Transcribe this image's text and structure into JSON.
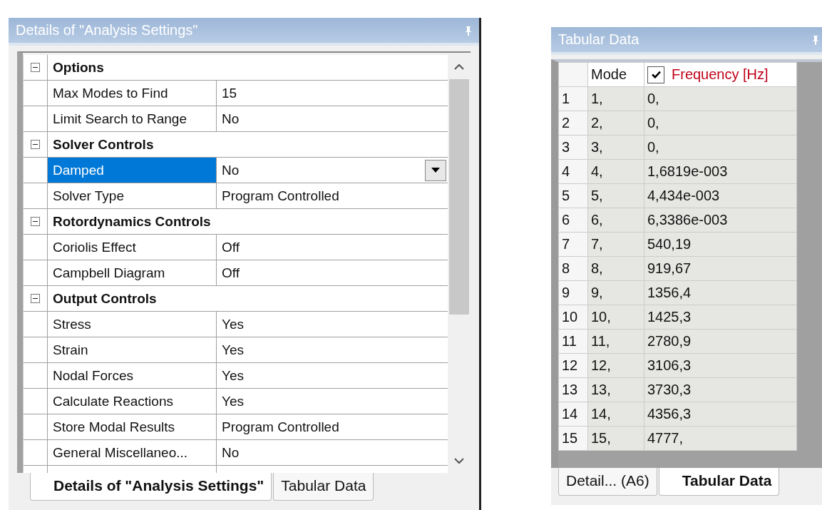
{
  "details_panel": {
    "title": "Details of \"Analysis Settings\"",
    "sections": [
      {
        "label": "Options",
        "expanded": true,
        "rows": [
          {
            "label": "Max Modes to Find",
            "value": "15",
            "selected": false
          },
          {
            "label": "Limit Search to Range",
            "value": "No",
            "selected": false
          }
        ]
      },
      {
        "label": "Solver Controls",
        "expanded": true,
        "rows": [
          {
            "label": "Damped",
            "value": "No",
            "selected": true
          },
          {
            "label": "Solver Type",
            "value": "Program Controlled",
            "selected": false
          }
        ]
      },
      {
        "label": "Rotordynamics Controls",
        "expanded": true,
        "rows": [
          {
            "label": "Coriolis Effect",
            "value": "Off",
            "selected": false
          },
          {
            "label": "Campbell Diagram",
            "value": "Off",
            "selected": false
          }
        ]
      },
      {
        "label": "Output Controls",
        "expanded": true,
        "rows": [
          {
            "label": "Stress",
            "value": "Yes",
            "selected": false
          },
          {
            "label": "Strain",
            "value": "Yes",
            "selected": false
          },
          {
            "label": "Nodal Forces",
            "value": "Yes",
            "selected": false
          },
          {
            "label": "Calculate Reactions",
            "value": "Yes",
            "selected": false
          },
          {
            "label": "Store Modal Results",
            "value": "Program Controlled",
            "selected": false
          },
          {
            "label": "General Miscellaneo...",
            "value": "No",
            "selected": false
          }
        ]
      }
    ],
    "tabs": [
      {
        "label": "Details of \"Analysis Settings\"",
        "selected": true
      },
      {
        "label": "Tabular Data",
        "selected": false
      }
    ]
  },
  "tabular_panel": {
    "title": "Tabular Data",
    "columns": [
      {
        "kind": "text",
        "label": "Mode"
      },
      {
        "kind": "checkbox",
        "label": "Frequency [Hz]",
        "checked": true
      }
    ],
    "rows": [
      {
        "index": "1",
        "mode": "1,",
        "frequency": "0,"
      },
      {
        "index": "2",
        "mode": "2,",
        "frequency": "0,"
      },
      {
        "index": "3",
        "mode": "3,",
        "frequency": "0,"
      },
      {
        "index": "4",
        "mode": "4,",
        "frequency": "1,6819e-003"
      },
      {
        "index": "5",
        "mode": "5,",
        "frequency": "4,434e-003"
      },
      {
        "index": "6",
        "mode": "6,",
        "frequency": "6,3386e-003"
      },
      {
        "index": "7",
        "mode": "7,",
        "frequency": "540,19"
      },
      {
        "index": "8",
        "mode": "8,",
        "frequency": "919,67"
      },
      {
        "index": "9",
        "mode": "9,",
        "frequency": "1356,4"
      },
      {
        "index": "10",
        "mode": "10,",
        "frequency": "1425,3"
      },
      {
        "index": "11",
        "mode": "11,",
        "frequency": "2780,9"
      },
      {
        "index": "12",
        "mode": "12,",
        "frequency": "3106,3"
      },
      {
        "index": "13",
        "mode": "13,",
        "frequency": "3730,3"
      },
      {
        "index": "14",
        "mode": "14,",
        "frequency": "4356,3"
      },
      {
        "index": "15",
        "mode": "15,",
        "frequency": "4777,"
      }
    ],
    "tabs": [
      {
        "label": "Detail... (A6)",
        "selected": false
      },
      {
        "label": "Tabular Data",
        "selected": true
      }
    ]
  }
}
